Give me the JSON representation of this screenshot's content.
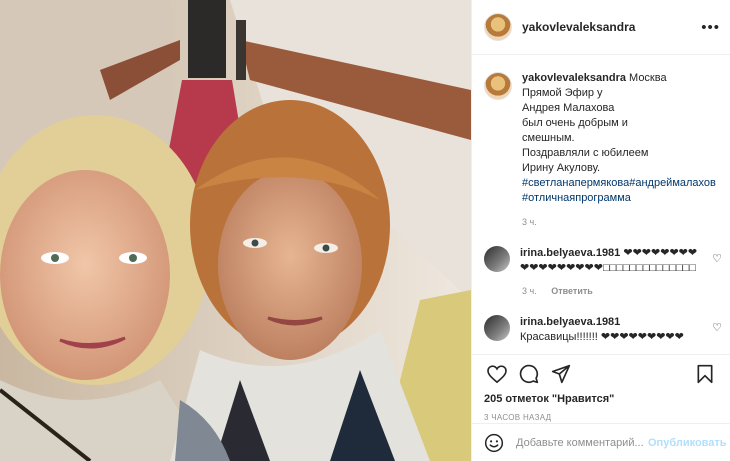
{
  "post": {
    "username": "yakovlevaleksandra",
    "more_label": "•••",
    "caption": {
      "username": "yakovlevaleksandra",
      "text_lines": [
        "Москва",
        "Прямой Эфир у",
        "Андрея Малахова",
        "был очень добрым и",
        "смешным.",
        "Поздравляли с юбилеем",
        "Ирину Акулову."
      ],
      "hashtags": "#светланапермякова#андреймалахов#отличнаяпрограмма",
      "time": "3 ч."
    },
    "comments": [
      {
        "username": "irina.belyaeva.1981",
        "text": "❤❤❤❤❤❤❤❤ ❤❤❤❤❤❤❤❤❤□□□□□□□□□□□□□□",
        "time": "3 ч.",
        "reply_label": "Ответить"
      },
      {
        "username": "irina.belyaeva.1981",
        "text": "Красавицы!!!!!!! ❤❤❤❤❤❤❤❤❤",
        "time": "",
        "reply_label": ""
      }
    ],
    "likes_text": "205 отметок \"Нравится\"",
    "time_ago": "3 ЧАСОВ НАЗАД",
    "add_comment_placeholder": "Добавьте комментарий...",
    "publish_label": "Опубликовать"
  },
  "icons": {
    "like": "heart-icon",
    "comment": "comment-icon",
    "share": "share-icon",
    "save": "bookmark-icon",
    "emoji": "emoji-icon"
  },
  "colors": {
    "link": "#00376b",
    "muted": "#8e8e8e",
    "publish_disabled": "#b2dffc"
  }
}
